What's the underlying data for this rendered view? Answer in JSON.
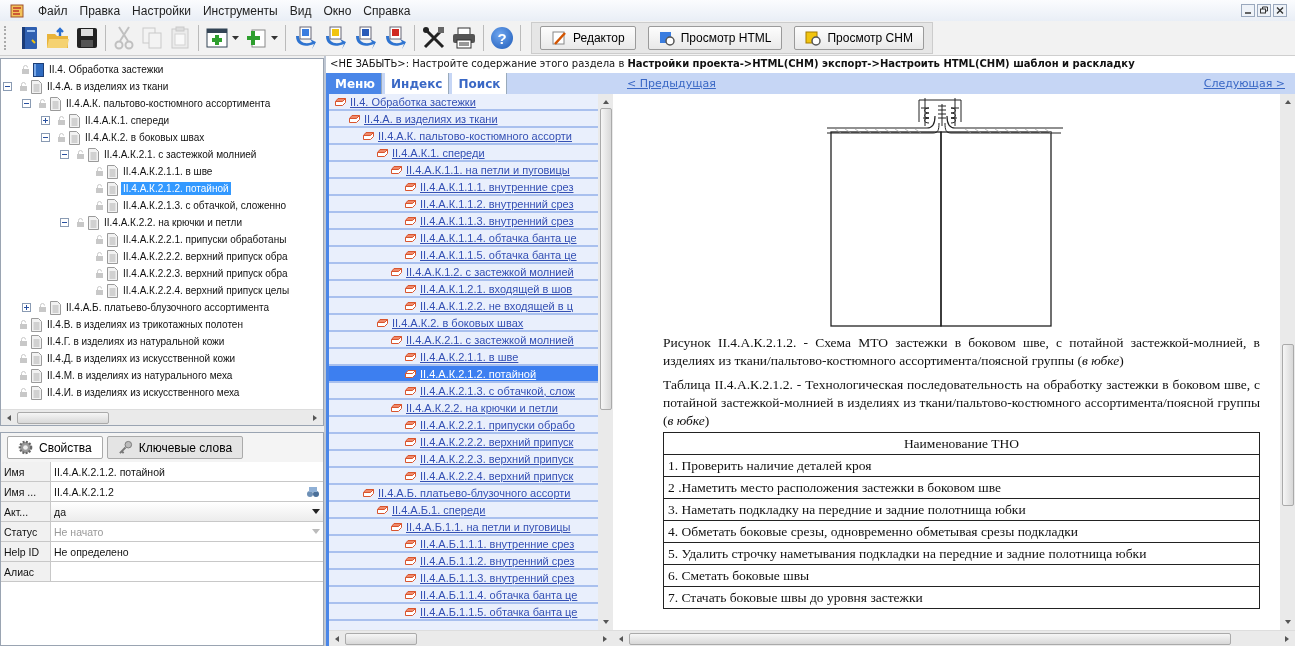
{
  "menu": [
    "Файл",
    "Правка",
    "Настройки",
    "Инструменты",
    "Вид",
    "Окно",
    "Справка"
  ],
  "toolbar": [
    {
      "kind": "book",
      "disabled": false
    },
    {
      "kind": "open",
      "disabled": false
    },
    {
      "kind": "save",
      "disabled": false
    },
    {
      "kind": "separator"
    },
    {
      "kind": "cut",
      "disabled": true
    },
    {
      "kind": "copy",
      "disabled": true
    },
    {
      "kind": "paste",
      "disabled": true
    },
    {
      "kind": "separator"
    },
    {
      "kind": "add-window",
      "disabled": false,
      "dropdown": true
    },
    {
      "kind": "add-page",
      "disabled": false,
      "dropdown": true
    },
    {
      "kind": "separator"
    },
    {
      "kind": "export-blue",
      "disabled": false
    },
    {
      "kind": "export-yellow",
      "disabled": false
    },
    {
      "kind": "export-word",
      "disabled": false
    },
    {
      "kind": "export-red",
      "disabled": false
    },
    {
      "kind": "separator"
    },
    {
      "kind": "tools",
      "disabled": false
    },
    {
      "kind": "print",
      "disabled": false
    },
    {
      "kind": "separator"
    },
    {
      "kind": "help",
      "disabled": false,
      "glyph": "?"
    }
  ],
  "view_buttons": [
    {
      "label": "Редактор",
      "kind": "pencil"
    },
    {
      "label": "Просмотр HTML",
      "kind": "html"
    },
    {
      "label": "Просмотр CHM",
      "kind": "chm"
    }
  ],
  "tree": [
    {
      "label": "II.4. Обработка застежки",
      "kind": "book",
      "selected": false,
      "children": [
        {
          "label": "II.4.А. в изделиях из ткани",
          "kind": "page",
          "selected": false,
          "expanded": true,
          "children": [
            {
              "label": "II.4.А.К. пальтово-костюмного ассортимента",
              "kind": "page",
              "selected": false,
              "expanded": true,
              "children": [
                {
                  "label": "II.4.А.К.1. спереди",
                  "kind": "page",
                  "selected": false,
                  "expanded": false
                },
                {
                  "label": "II.4.А.К.2. в боковых швах",
                  "kind": "page",
                  "selected": false,
                  "expanded": true,
                  "children": [
                    {
                      "label": "II.4.А.К.2.1. с застежкой молнией",
                      "kind": "page",
                      "selected": false,
                      "expanded": true,
                      "children": [
                        {
                          "label": "II.4.А.К.2.1.1. в шве",
                          "kind": "page",
                          "selected": false
                        },
                        {
                          "label": "II.4.А.К.2.1.2. потайной",
                          "kind": "page",
                          "selected": true
                        },
                        {
                          "label": "II.4.А.К.2.1.3. с обтачкой, сложенно",
                          "kind": "page",
                          "selected": false
                        }
                      ]
                    },
                    {
                      "label": "II.4.А.К.2.2. на крючки и петли",
                      "kind": "page",
                      "selected": false,
                      "expanded": true,
                      "children": [
                        {
                          "label": "II.4.А.К.2.2.1. припуски обработаны",
                          "kind": "page",
                          "selected": false
                        },
                        {
                          "label": "II.4.А.К.2.2.2. верхний припуск обра",
                          "kind": "page",
                          "selected": false
                        },
                        {
                          "label": "II.4.А.К.2.2.3. верхний припуск обра",
                          "kind": "page",
                          "selected": false
                        },
                        {
                          "label": "II.4.А.К.2.2.4. верхний припуск целы",
                          "kind": "page",
                          "selected": false
                        }
                      ]
                    }
                  ]
                }
              ]
            },
            {
              "label": "II.4.А.Б. платьево-блузочного ассортимента",
              "kind": "page",
              "selected": false,
              "expanded": false
            }
          ]
        },
        {
          "label": "II.4.В. в изделиях из трикотажных полотен",
          "kind": "page",
          "selected": false
        },
        {
          "label": "II.4.Г. в изделиях из натуральной кожи",
          "kind": "page",
          "selected": false
        },
        {
          "label": "II.4.Д. в изделиях из искусственной кожи",
          "kind": "page",
          "selected": false
        },
        {
          "label": "II.4.М. в изделиях из натурального меха",
          "kind": "page",
          "selected": false
        },
        {
          "label": "II.4.И. в изделиях из искусственного меха",
          "kind": "page",
          "selected": false
        }
      ]
    }
  ],
  "properties": {
    "tabs": [
      {
        "label": "Свойства",
        "kind": "gear",
        "selected": true
      },
      {
        "label": "Ключевые слова",
        "kind": "key",
        "selected": false
      }
    ],
    "rows": [
      {
        "label": "Имя",
        "value": "II.4.А.К.2.1.2. потайной",
        "kind": "text"
      },
      {
        "label": "Имя ...",
        "value": "II.4.А.К.2.1.2",
        "kind": "lookup"
      },
      {
        "label": "Акт...",
        "value": "да",
        "kind": "dropdown",
        "disabled": false
      },
      {
        "label": "Статус",
        "value": "Не начато",
        "kind": "dropdown",
        "disabled": true
      },
      {
        "label": "Help ID",
        "value": "Не определено",
        "kind": "text"
      },
      {
        "label": "Алиас",
        "kind": "text"
      }
    ]
  },
  "notice": "<НЕ ЗАБЫТЬ>: Настройте содержание этого раздела в **Настройки проекта->HTML(CHM) экспорт->Настроить HTML(CHM) шаблон и раскладку**",
  "nav_tabs": [
    {
      "label": "Меню",
      "selected": true
    },
    {
      "label": "Индекс",
      "selected": false
    },
    {
      "label": "Поиск",
      "selected": false
    }
  ],
  "toc": [
    {
      "label": "II.4. Обработка застежки",
      "selected": false,
      "children": [
        {
          "label": "II.4.А. в изделиях из ткани",
          "selected": false,
          "children": [
            {
              "label": "II.4.А.К. пальтово-костюмного ассорти",
              "selected": false,
              "children": [
                {
                  "label": "II.4.А.К.1. спереди",
                  "selected": false,
                  "children": [
                    {
                      "label": "II.4.А.К.1.1. на петли и пуговицы",
                      "selected": false,
                      "children": [
                        {
                          "label": "II.4.А.К.1.1.1. внутренние срез",
                          "selected": false
                        },
                        {
                          "label": "II.4.А.К.1.1.2. внутренний срез",
                          "selected": false
                        },
                        {
                          "label": "II.4.А.К.1.1.3. внутренний срез",
                          "selected": false
                        },
                        {
                          "label": "II.4.А.К.1.1.4. обтачка банта це",
                          "selected": false
                        },
                        {
                          "label": "II.4.А.К.1.1.5. обтачка банта це",
                          "selected": false
                        }
                      ]
                    },
                    {
                      "label": "II.4.А.К.1.2. с застежкой молнией",
                      "selected": false,
                      "children": [
                        {
                          "label": "II.4.А.К.1.2.1. входящей в шов",
                          "selected": false
                        },
                        {
                          "label": "II.4.А.К.1.2.2. не входящей в ц",
                          "selected": false
                        }
                      ]
                    }
                  ]
                },
                {
                  "label": "II.4.А.К.2. в боковых швах",
                  "selected": false,
                  "children": [
                    {
                      "label": "II.4.А.К.2.1. с застежкой молнией",
                      "selected": false,
                      "children": [
                        {
                          "label": "II.4.А.К.2.1.1. в шве",
                          "selected": false
                        },
                        {
                          "label": "II.4.А.К.2.1.2. потайной",
                          "selected": true
                        },
                        {
                          "label": "II.4.А.К.2.1.3. с обтачкой, слож",
                          "selected": false
                        }
                      ]
                    },
                    {
                      "label": "II.4.А.К.2.2. на крючки и петли",
                      "selected": false,
                      "children": [
                        {
                          "label": "II.4.А.К.2.2.1. припуски обрабо",
                          "selected": false
                        },
                        {
                          "label": "II.4.А.К.2.2.2. верхний припуск",
                          "selected": false
                        },
                        {
                          "label": "II.4.А.К.2.2.3. верхний припуск",
                          "selected": false
                        },
                        {
                          "label": "II.4.А.К.2.2.4. верхний припуск",
                          "selected": false
                        }
                      ]
                    }
                  ]
                }
              ]
            },
            {
              "label": "II.4.А.Б. платьево-блузочного ассорти",
              "selected": false,
              "children": [
                {
                  "label": "II.4.А.Б.1. спереди",
                  "selected": false,
                  "children": [
                    {
                      "label": "II.4.А.Б.1.1. на петли и пуговицы",
                      "selected": false,
                      "children": [
                        {
                          "label": "II.4.А.Б.1.1.1. внутренние срез",
                          "selected": false
                        },
                        {
                          "label": "II.4.А.Б.1.1.2. внутренний срез",
                          "selected": false
                        },
                        {
                          "label": "II.4.А.Б.1.1.3. внутренний срез",
                          "selected": false
                        },
                        {
                          "label": "II.4.А.Б.1.1.4. обтачка банта це",
                          "selected": false
                        },
                        {
                          "label": "II.4.А.Б.1.1.5. обтачка банта це",
                          "selected": false
                        }
                      ]
                    }
                  ]
                }
              ]
            }
          ]
        }
      ]
    }
  ],
  "page_nav": {
    "previous": "< Предыдущая",
    "next": "Следующая >"
  },
  "figure_caption": "Рисунок II.4.А.К.2.1.2. - Схема МТО застежки в боковом шве, с потайной застежкой-молнией, в изделиях из ткани/пальтово-костюмного ассортимента/поясной группы (*в юбке*)",
  "table_caption": "Таблица II.4.А.К.2.1.2. - Технологическая последовательность на обработку застежки в боковом шве, с потайной застежкой-молнией в изделиях из ткани/пальтово-костюмного ассортимента/поясной группы (*в юбке*)",
  "table": {
    "columns": [
      "Наименование ТНО"
    ],
    "rows": [
      "1. Проверить наличие деталей кроя",
      "2 .Наметить место расположения застежки в боковом шве",
      "3. Наметать подкладку на передние и задние полотнища юбки",
      "4. Обметать боковые срезы, одновременно обметывая срезы подкладки",
      "5. Удалить строчку наметывания подкладки на передние и задние полотнища юбки",
      "6. Сметать боковые швы",
      "7. Стачать боковые швы до уровня застежки"
    ]
  }
}
